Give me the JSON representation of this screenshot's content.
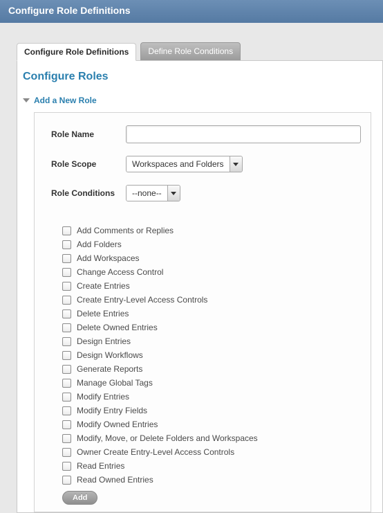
{
  "header": {
    "title": "Configure Role Definitions"
  },
  "tabs": {
    "active": "Configure Role Definitions",
    "inactive": "Define Role Conditions"
  },
  "section_title": "Configure Roles",
  "accordion": {
    "label": "Add a New Role"
  },
  "form": {
    "role_name": {
      "label": "Role Name",
      "value": ""
    },
    "role_scope": {
      "label": "Role Scope",
      "value": "Workspaces and Folders"
    },
    "role_conditions": {
      "label": "Role Conditions",
      "value": "--none--"
    }
  },
  "permissions": [
    "Add Comments or Replies",
    "Add Folders",
    "Add Workspaces",
    "Change Access Control",
    "Create Entries",
    "Create Entry-Level Access Controls",
    "Delete Entries",
    "Delete Owned Entries",
    "Design Entries",
    "Design Workflows",
    "Generate Reports",
    "Manage Global Tags",
    "Modify Entries",
    "Modify Entry Fields",
    "Modify Owned Entries",
    "Modify, Move, or Delete Folders and Workspaces",
    "Owner Create Entry-Level Access Controls",
    "Read Entries",
    "Read Owned Entries"
  ],
  "buttons": {
    "add": "Add"
  }
}
